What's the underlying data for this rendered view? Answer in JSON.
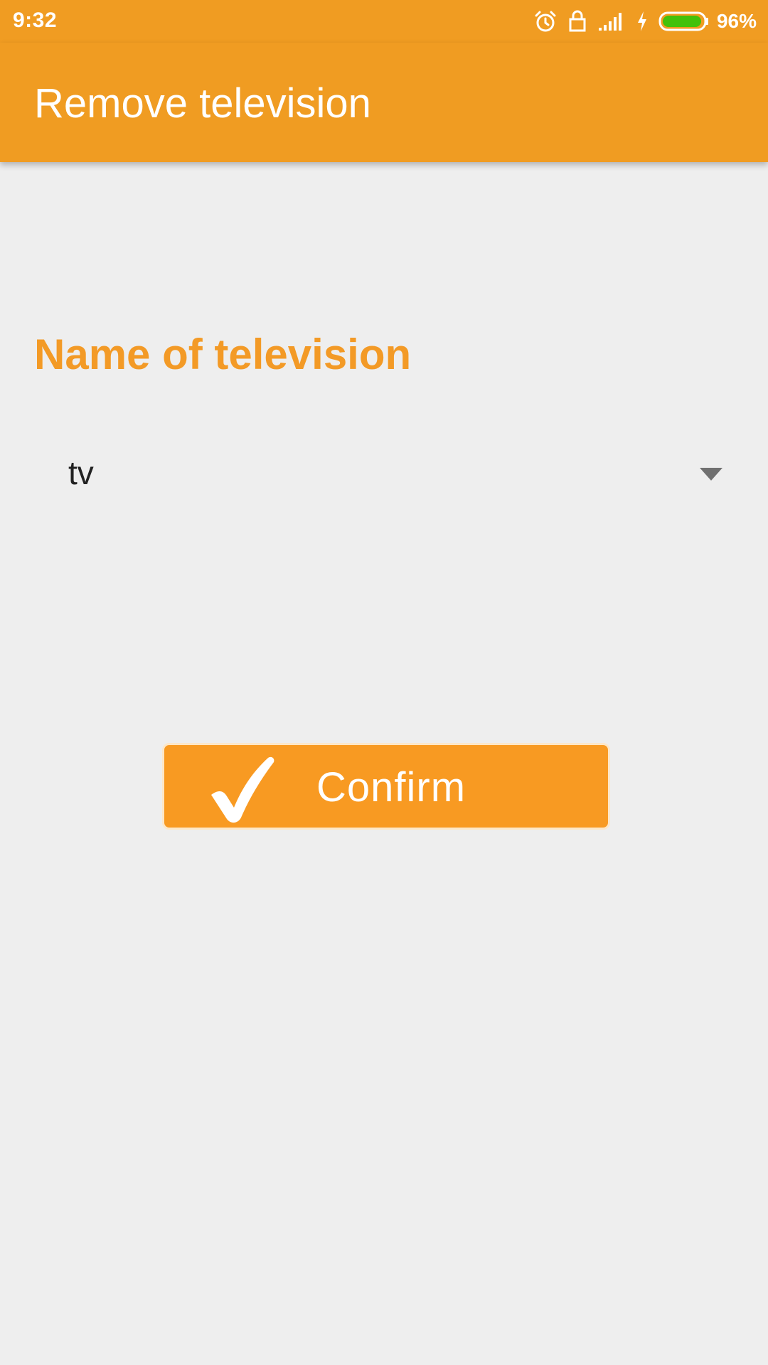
{
  "status_bar": {
    "time": "9:32",
    "battery_percent": "96%",
    "battery_level": 0.96,
    "battery_color": "#43c10a",
    "icons": [
      "alarm-icon",
      "lock-icon",
      "signal-icon",
      "charging-icon",
      "battery-icon"
    ]
  },
  "app_bar": {
    "title": "Remove television",
    "color": "#f09c22"
  },
  "form": {
    "label": "Name of television",
    "label_color": "#f39a26",
    "spinner": {
      "selected": "tv"
    }
  },
  "confirm_button": {
    "label": "Confirm",
    "icon": "checkmark-icon",
    "color": "#f89a22"
  }
}
